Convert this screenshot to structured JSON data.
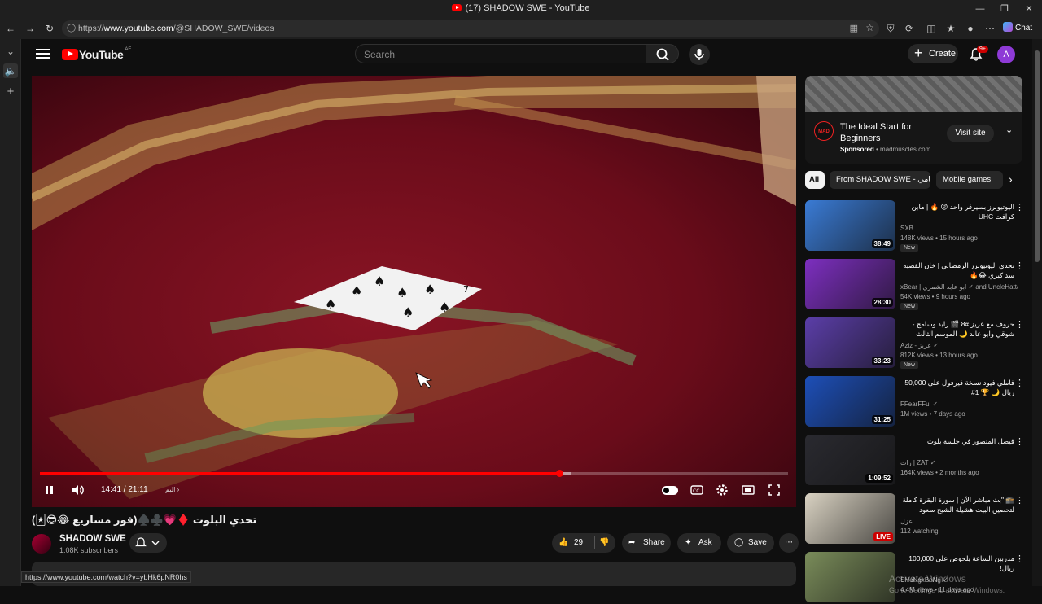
{
  "browser": {
    "title": "(17) SHADOW SWE - YouTube",
    "url_prefix": "https://",
    "url_host": "www.youtube.com",
    "url_path": "/@SHADOW_SWE/videos",
    "copilot_label": "Chat"
  },
  "masthead": {
    "logo_text": "YouTube",
    "region": "AE",
    "search_placeholder": "Search",
    "create_label": "Create",
    "notif_badge": "9+",
    "avatar_letter": "A"
  },
  "player": {
    "time": "14:41 / 21:11",
    "chapter": "البم",
    "progress_fraction": 0.694,
    "buffer_fraction": 0.71,
    "card_rank": "7"
  },
  "video": {
    "title": "تحدي البلوت ♦️💗♣️♠️(فوز مشاريع 😂😎🃏)",
    "channel": "SHADOW SWE",
    "subscribers": "1.08K subscribers",
    "likes": "29",
    "share_label": "Share",
    "ask_label": "Ask",
    "save_label": "Save"
  },
  "ad": {
    "title": "The Ideal Start for Beginners",
    "sponsored": "Sponsored",
    "domain": "madmuscles.com",
    "logo_text": "MAD",
    "cta": "Visit site"
  },
  "chips": [
    "All",
    "From SHADOW SWE - سامي",
    "Mobile games"
  ],
  "recs": [
    {
      "title": "اليوتيوبرز بسيرفر واحد 😡 🔥 | مابن كرافت UHC",
      "channel": "SXB",
      "views": "148K views • 15 hours ago",
      "badge": "New",
      "duration": "38:49",
      "thumb_color": "#3a7bd5"
    },
    {
      "title": "تحدي اليوتيوبرز الرمضاني | خان القضبه سد كبري 😂🔥",
      "channel": "xBear | ابو عابد الشمري ✓ and UncleHattan |...",
      "views": "54K views • 9 hours ago",
      "badge": "New",
      "duration": "28:30",
      "thumb_color": "#7d2fc0"
    },
    {
      "title": "حروف مع عزيز #8 🎬 رايد وسامح - شوقي وابو عابد 🌙 الموسم الثالث",
      "channel": "Aziz - عزيز ✓",
      "views": "812K views • 13 hours ago",
      "badge": "New",
      "duration": "33:23",
      "thumb_color": "#5b3ea8"
    },
    {
      "title": "فاملي فيود نسخة فيرفول على 50,000 ريال 🌙 🏆 1#",
      "channel": "FFearFFul ✓",
      "views": "1M views • 7 days ago",
      "badge": "",
      "duration": "31:25",
      "thumb_color": "#1d4fb8"
    },
    {
      "title": "فيصل المنصور في جلسة بلوت",
      "channel": "زات | ZAT ✓",
      "views": "164K views • 2 months ago",
      "badge": "",
      "duration": "1:09:52",
      "thumb_color": "#2a2a30"
    },
    {
      "title": "🕋 \"بث مباشر الآن | سورة البقرة كاملة لتحصين البيت هشيلة الشيخ سعود الشريم ...",
      "channel": "عزل",
      "views": "112 watching",
      "badge": "",
      "duration": "LIVE",
      "thumb_color": "#d9d2c2"
    },
    {
      "title": "مدربين الساعة بلحوض على 100,000 ريال!",
      "channel": "SHoNgxBoNg ✓",
      "views": "4.4M views • 11 days ago",
      "badge": "",
      "duration": "",
      "thumb_color": "#7a8c5a"
    }
  ],
  "status_url": "https://www.youtube.com/watch?v=ybHk6pNR0hs",
  "watermark": {
    "line1": "Activate Windows",
    "line2": "Go to Settings to activate Windows."
  }
}
